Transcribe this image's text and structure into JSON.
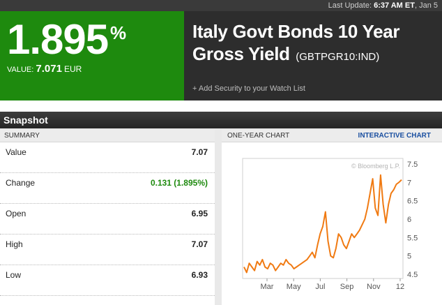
{
  "top_bar": {
    "prefix": "Last Update:",
    "time": "6:37 AM ET",
    "date": ", Jan 5"
  },
  "quote": {
    "value": "1.895",
    "pct_symbol": "%",
    "sub_label": "VALUE:",
    "sub_value": "7.071",
    "currency": "EUR"
  },
  "title": {
    "line1": "Italy Govt Bonds 10 Year",
    "line2": "Gross Yield",
    "ticker": "(GBTPGR10:IND)",
    "watchlist_link": "+ Add Security to your Watch List"
  },
  "snapshot": {
    "label": "Snapshot"
  },
  "summary": {
    "header": "SUMMARY",
    "rows": [
      {
        "label": "Value",
        "value": "7.07"
      },
      {
        "label": "Change",
        "value": "0.131 (1.895%)"
      },
      {
        "label": "Open",
        "value": "6.95"
      },
      {
        "label": "High",
        "value": "7.07"
      },
      {
        "label": "Low",
        "value": "6.93"
      }
    ]
  },
  "chart_panel": {
    "header": "ONE-YEAR CHART",
    "link": "INTERACTIVE CHART",
    "watermark": "© Bloomberg L.P."
  },
  "colors": {
    "green": "#1e8a0e",
    "line": "#f07a12",
    "link": "#1a4fa0"
  },
  "chart_data": {
    "type": "line",
    "x_ticks": [
      "Mar",
      "May",
      "Jul",
      "Sep",
      "Nov",
      "12"
    ],
    "y_ticks": [
      "7.5",
      "7",
      "6.5",
      "6",
      "5.5",
      "5",
      "4.5"
    ],
    "ylim": [
      4.5,
      7.5
    ],
    "grid": false,
    "series": [
      {
        "values": [
          4.7,
          4.55,
          4.8,
          4.7,
          4.6,
          4.85,
          4.75,
          4.9,
          4.7,
          4.65,
          4.8,
          4.75,
          4.6,
          4.7,
          4.8,
          4.75,
          4.9,
          4.8,
          4.75,
          4.65,
          4.7,
          4.75,
          4.8,
          4.85,
          4.9,
          5.0,
          5.1,
          4.95,
          5.3,
          5.6,
          5.8,
          6.2,
          5.4,
          5.0,
          4.95,
          5.2,
          5.6,
          5.5,
          5.3,
          5.2,
          5.4,
          5.6,
          5.5,
          5.6,
          5.7,
          5.85,
          6.0,
          6.3,
          6.7,
          7.1,
          6.3,
          6.1,
          7.2,
          6.4,
          5.9,
          6.4,
          6.7,
          6.8,
          6.95,
          7.0,
          7.07
        ]
      }
    ]
  }
}
